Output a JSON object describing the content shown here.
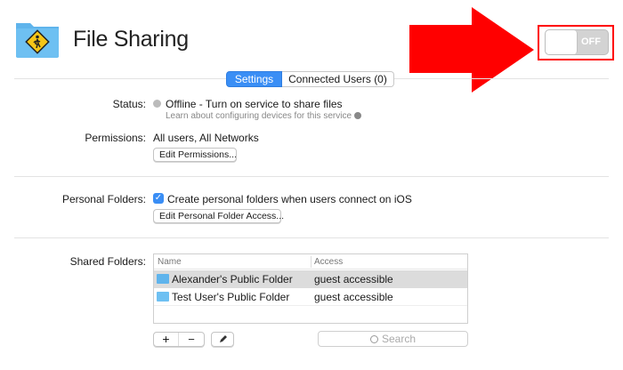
{
  "header": {
    "title": "File Sharing",
    "toggle_label": "OFF",
    "toggle_on": false
  },
  "tabs": [
    {
      "label": "Settings",
      "active": true
    },
    {
      "label": "Connected Users (0)",
      "active": false
    }
  ],
  "status": {
    "label": "Status:",
    "value": "Offline - Turn on service to share files",
    "link": "Learn about configuring devices for this service"
  },
  "permissions": {
    "label": "Permissions:",
    "value": "All users, All Networks",
    "button": "Edit Permissions..."
  },
  "personal_folders": {
    "label": "Personal Folders:",
    "checkbox_label": "Create personal folders when users connect on iOS",
    "checked": true,
    "button": "Edit Personal Folder Access..."
  },
  "shared_folders": {
    "label": "Shared Folders:",
    "columns": [
      "Name",
      "Access"
    ],
    "rows": [
      {
        "name": "Alexander's Public Folder",
        "access": "guest accessible",
        "selected": true
      },
      {
        "name": "Test User's Public Folder",
        "access": "guest accessible",
        "selected": false
      }
    ],
    "add": "+",
    "remove": "−",
    "search_placeholder": "Search"
  },
  "colors": {
    "accent": "#3a8ef5",
    "arrow": "#ff0000"
  }
}
